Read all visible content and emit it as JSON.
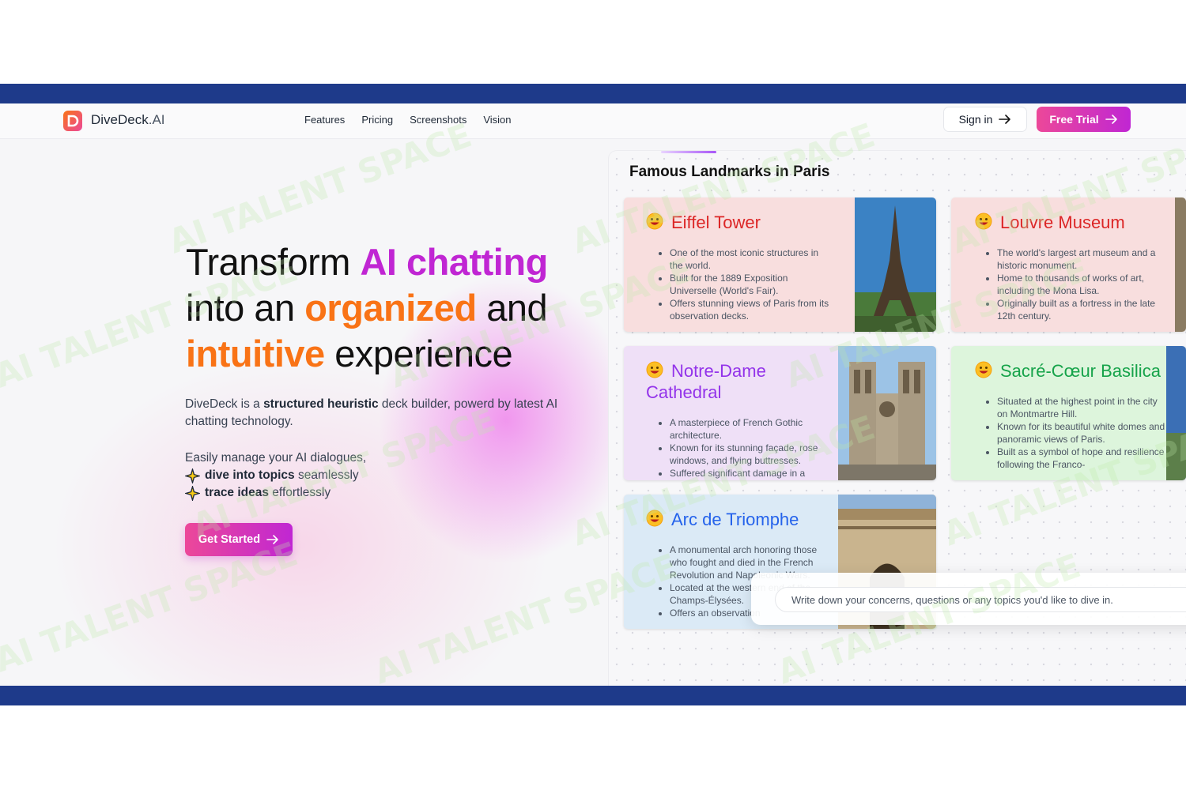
{
  "nav": {
    "brand_name": "DiveDeck",
    "brand_suffix": ".AI",
    "links": [
      "Features",
      "Pricing",
      "Screenshots",
      "Vision"
    ],
    "sign_in": "Sign in",
    "free_trial": "Free Trial"
  },
  "hero": {
    "line1_plain": "Transform ",
    "line1_accent": "AI chatting",
    "line2_plain_a": "into an ",
    "line2_accent": "organized",
    "line2_plain_b": " and",
    "line3_accent": "intuitive",
    "line3_plain": " experience",
    "desc_a": "DiveDeck is a ",
    "desc_bold": "structured heuristic",
    "desc_b": " deck builder, powerd by latest AI chatting technology.",
    "manage": "Easily manage your AI dialogues,",
    "bullet1_bold": "dive into topics",
    "bullet1_rest": " seamlessly",
    "bullet2_bold": "trace ideas",
    "bullet2_rest": " effortlessly",
    "cta": "Get Started"
  },
  "panel": {
    "title": "Famous Landmarks in Paris",
    "cards": [
      {
        "title": "Eiffel Tower",
        "bullets": [
          "One of the most iconic structures in the world.",
          "Built for the 1889 Exposition Universelle (World's Fair).",
          "Offers stunning views of Paris from its observation decks."
        ]
      },
      {
        "title": "Louvre Museum",
        "bullets": [
          "The world's largest art museum and a historic monument.",
          "Home to thousands of works of art, including the Mona Lisa.",
          "Originally built as a fortress in the late 12th century."
        ]
      },
      {
        "title": "Notre-Dame Cathedral",
        "bullets": [
          "A masterpiece of French Gothic architecture.",
          "Known for its stunning façade, rose windows, and flying buttresses.",
          "Suffered significant damage in a"
        ]
      },
      {
        "title": "Sacré-Cœur Basilica",
        "bullets": [
          "Situated at the highest point in the city on Montmartre Hill.",
          "Known for its beautiful white domes and panoramic views of Paris.",
          "Built as a symbol of hope and resilience following the Franco-"
        ]
      },
      {
        "title": "Arc de Triomphe",
        "bullets": [
          "A monumental arch honoring those who fought and died in the French Revolution and Napoleonic Wars.",
          "Located at the western end of the Champs-Élysées.",
          "Offers an observation"
        ]
      }
    ]
  },
  "chat": {
    "placeholder": "Write down your concerns, questions or any topics you'd like to dive in."
  },
  "watermark": {
    "text": "AI TALENT SPACE"
  },
  "colors": {
    "band": "#1e3a8a",
    "accent_pink": "#ec4899",
    "accent_purple": "#c026d3",
    "accent_orange": "#f97316",
    "card_red": "#f8dede",
    "card_purple": "#efe0f7",
    "card_green": "#ddf5dc",
    "card_blue": "#dbeaf6"
  }
}
